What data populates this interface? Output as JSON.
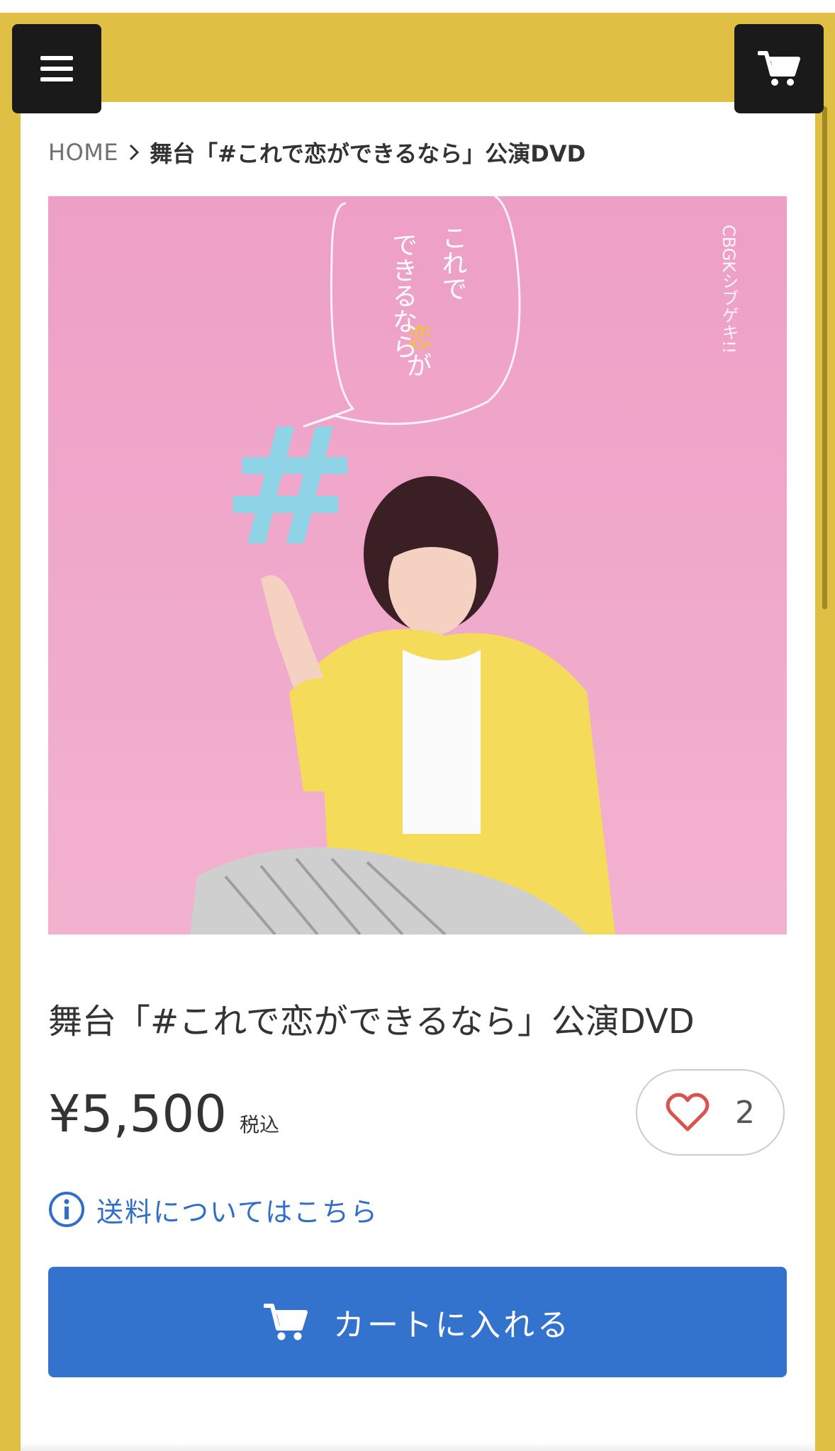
{
  "header": {
    "menu_icon": "hamburger-icon",
    "cart_icon": "cart-icon",
    "bar_color": "#dfbf44"
  },
  "breadcrumb": {
    "home": "HOME",
    "separator_icon": "chevron-right-icon",
    "current": "舞台「#これで恋ができるなら」公演DVD"
  },
  "product": {
    "image": {
      "vertical_title_line1": "これで",
      "vertical_title_line2_a": "恋",
      "vertical_title_line2_b": "が",
      "vertical_title_line3": "できるなら",
      "side_text": "CBGKシブゲキ!!",
      "symbol": "#"
    },
    "title": "舞台「#これで恋ができるなら」公演DVD",
    "price": "¥5,500",
    "tax_label": "税込",
    "like_count": "2",
    "like_icon": "heart-icon",
    "shipping_info_icon": "info-icon",
    "shipping_link": "送料についてはこちら",
    "add_to_cart": "カートに入れる"
  },
  "colors": {
    "accent_blue": "#3372cd",
    "link_blue": "#2f6fc9",
    "like_heart": "#d9534f",
    "image_background": "#f0a9c8"
  }
}
